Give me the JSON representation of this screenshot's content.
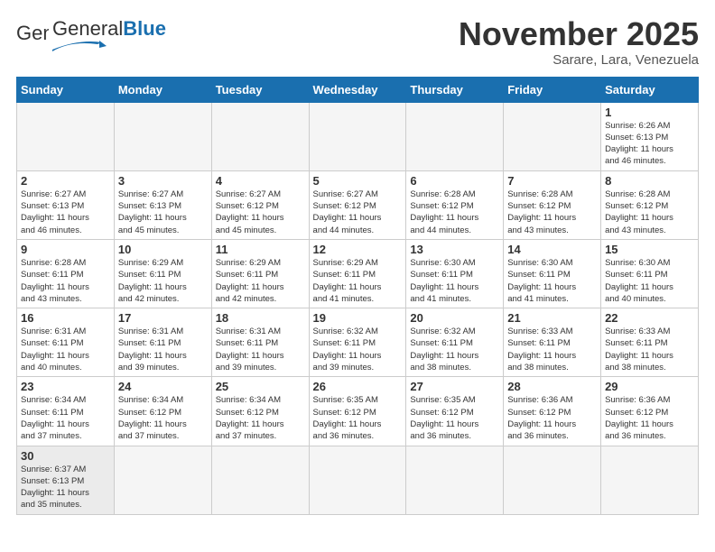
{
  "header": {
    "logo_general": "General",
    "logo_blue": "Blue",
    "month_title": "November 2025",
    "subtitle": "Sarare, Lara, Venezuela"
  },
  "weekdays": [
    "Sunday",
    "Monday",
    "Tuesday",
    "Wednesday",
    "Thursday",
    "Friday",
    "Saturday"
  ],
  "weeks": [
    [
      {
        "day": "",
        "info": ""
      },
      {
        "day": "",
        "info": ""
      },
      {
        "day": "",
        "info": ""
      },
      {
        "day": "",
        "info": ""
      },
      {
        "day": "",
        "info": ""
      },
      {
        "day": "",
        "info": ""
      },
      {
        "day": "1",
        "info": "Sunrise: 6:26 AM\nSunset: 6:13 PM\nDaylight: 11 hours\nand 46 minutes."
      }
    ],
    [
      {
        "day": "2",
        "info": "Sunrise: 6:27 AM\nSunset: 6:13 PM\nDaylight: 11 hours\nand 46 minutes."
      },
      {
        "day": "3",
        "info": "Sunrise: 6:27 AM\nSunset: 6:13 PM\nDaylight: 11 hours\nand 45 minutes."
      },
      {
        "day": "4",
        "info": "Sunrise: 6:27 AM\nSunset: 6:12 PM\nDaylight: 11 hours\nand 45 minutes."
      },
      {
        "day": "5",
        "info": "Sunrise: 6:27 AM\nSunset: 6:12 PM\nDaylight: 11 hours\nand 44 minutes."
      },
      {
        "day": "6",
        "info": "Sunrise: 6:28 AM\nSunset: 6:12 PM\nDaylight: 11 hours\nand 44 minutes."
      },
      {
        "day": "7",
        "info": "Sunrise: 6:28 AM\nSunset: 6:12 PM\nDaylight: 11 hours\nand 43 minutes."
      },
      {
        "day": "8",
        "info": "Sunrise: 6:28 AM\nSunset: 6:12 PM\nDaylight: 11 hours\nand 43 minutes."
      }
    ],
    [
      {
        "day": "9",
        "info": "Sunrise: 6:28 AM\nSunset: 6:11 PM\nDaylight: 11 hours\nand 43 minutes."
      },
      {
        "day": "10",
        "info": "Sunrise: 6:29 AM\nSunset: 6:11 PM\nDaylight: 11 hours\nand 42 minutes."
      },
      {
        "day": "11",
        "info": "Sunrise: 6:29 AM\nSunset: 6:11 PM\nDaylight: 11 hours\nand 42 minutes."
      },
      {
        "day": "12",
        "info": "Sunrise: 6:29 AM\nSunset: 6:11 PM\nDaylight: 11 hours\nand 41 minutes."
      },
      {
        "day": "13",
        "info": "Sunrise: 6:30 AM\nSunset: 6:11 PM\nDaylight: 11 hours\nand 41 minutes."
      },
      {
        "day": "14",
        "info": "Sunrise: 6:30 AM\nSunset: 6:11 PM\nDaylight: 11 hours\nand 41 minutes."
      },
      {
        "day": "15",
        "info": "Sunrise: 6:30 AM\nSunset: 6:11 PM\nDaylight: 11 hours\nand 40 minutes."
      }
    ],
    [
      {
        "day": "16",
        "info": "Sunrise: 6:31 AM\nSunset: 6:11 PM\nDaylight: 11 hours\nand 40 minutes."
      },
      {
        "day": "17",
        "info": "Sunrise: 6:31 AM\nSunset: 6:11 PM\nDaylight: 11 hours\nand 39 minutes."
      },
      {
        "day": "18",
        "info": "Sunrise: 6:31 AM\nSunset: 6:11 PM\nDaylight: 11 hours\nand 39 minutes."
      },
      {
        "day": "19",
        "info": "Sunrise: 6:32 AM\nSunset: 6:11 PM\nDaylight: 11 hours\nand 39 minutes."
      },
      {
        "day": "20",
        "info": "Sunrise: 6:32 AM\nSunset: 6:11 PM\nDaylight: 11 hours\nand 38 minutes."
      },
      {
        "day": "21",
        "info": "Sunrise: 6:33 AM\nSunset: 6:11 PM\nDaylight: 11 hours\nand 38 minutes."
      },
      {
        "day": "22",
        "info": "Sunrise: 6:33 AM\nSunset: 6:11 PM\nDaylight: 11 hours\nand 38 minutes."
      }
    ],
    [
      {
        "day": "23",
        "info": "Sunrise: 6:34 AM\nSunset: 6:11 PM\nDaylight: 11 hours\nand 37 minutes."
      },
      {
        "day": "24",
        "info": "Sunrise: 6:34 AM\nSunset: 6:12 PM\nDaylight: 11 hours\nand 37 minutes."
      },
      {
        "day": "25",
        "info": "Sunrise: 6:34 AM\nSunset: 6:12 PM\nDaylight: 11 hours\nand 37 minutes."
      },
      {
        "day": "26",
        "info": "Sunrise: 6:35 AM\nSunset: 6:12 PM\nDaylight: 11 hours\nand 36 minutes."
      },
      {
        "day": "27",
        "info": "Sunrise: 6:35 AM\nSunset: 6:12 PM\nDaylight: 11 hours\nand 36 minutes."
      },
      {
        "day": "28",
        "info": "Sunrise: 6:36 AM\nSunset: 6:12 PM\nDaylight: 11 hours\nand 36 minutes."
      },
      {
        "day": "29",
        "info": "Sunrise: 6:36 AM\nSunset: 6:12 PM\nDaylight: 11 hours\nand 36 minutes."
      }
    ],
    [
      {
        "day": "30",
        "info": "Sunrise: 6:37 AM\nSunset: 6:13 PM\nDaylight: 11 hours\nand 35 minutes."
      },
      {
        "day": "",
        "info": ""
      },
      {
        "day": "",
        "info": ""
      },
      {
        "day": "",
        "info": ""
      },
      {
        "day": "",
        "info": ""
      },
      {
        "day": "",
        "info": ""
      },
      {
        "day": "",
        "info": ""
      }
    ]
  ]
}
